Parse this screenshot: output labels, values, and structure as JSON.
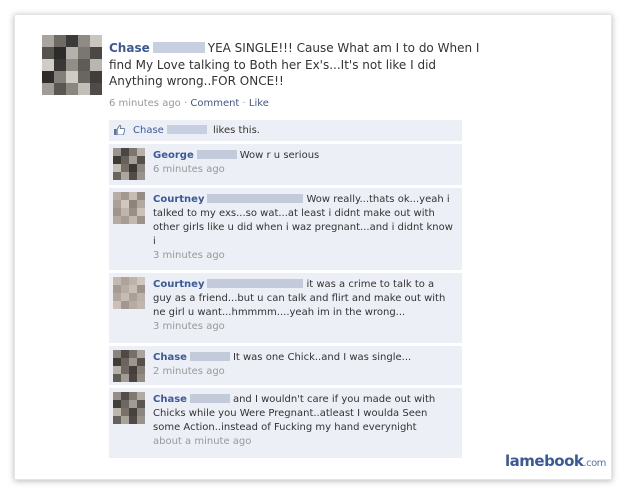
{
  "post": {
    "author": "Chase",
    "status_text": "YEA SINGLE!!! Cause What am I to do When I find My Love talking to Both her Ex's...It's not like I did Anything wrong..FOR ONCE!!",
    "timestamp": "6 minutes ago",
    "separator": "·",
    "comment_link": "Comment",
    "like_link": "Like"
  },
  "likes": {
    "name": "Chase",
    "text": "likes this.",
    "icon": "thumbs-up-icon"
  },
  "comments": [
    {
      "author": "George",
      "text": "Wow r u serious",
      "time": "6 minutes ago"
    },
    {
      "author": "Courtney",
      "text": "Wow really...thats ok...yeah i talked to my exs...so wat...at least i didnt make out with other girls like u did when i waz pregnant...and i didnt know i",
      "time": "3 minutes ago"
    },
    {
      "author": "Courtney",
      "text": "it was a crime to talk to a guy as a friend...but u can talk and flirt and make out with ne girl u want...hmmmm....yeah im in the wrong...",
      "time": "3 minutes ago"
    },
    {
      "author": "Chase",
      "text": "It was one Chick..and I was single...",
      "time": "2 minutes ago"
    },
    {
      "author": "Chase",
      "text": "and I wouldn't care if you made out with Chicks while you Were Pregnant..atleast I woulda Seen some Action..instead of Fucking my hand everynight",
      "time": "about a minute ago"
    }
  ],
  "watermark": {
    "brand": "lamebook",
    "tld": ".com"
  },
  "colors": {
    "link": "#3b5998",
    "feedback_bg": "#eceff5",
    "muted": "#999999"
  }
}
